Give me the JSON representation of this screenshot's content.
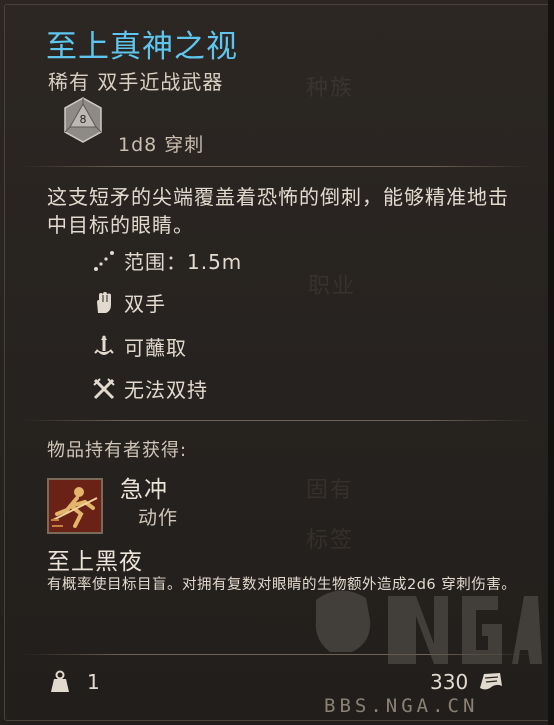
{
  "item": {
    "name": "至上真神之视",
    "rarity_type": "稀有 双手近战武器",
    "die_value": "8",
    "damage": "1d8 穿刺",
    "description": "这支短矛的尖端覆盖着恐怖的倒刺，能够精准地击中目标的眼睛。",
    "properties": [
      {
        "icon": "range-icon",
        "label": "范围：1.5m"
      },
      {
        "icon": "two-handed-icon",
        "label": "双手"
      },
      {
        "icon": "dippable-icon",
        "label": "可蘸取"
      },
      {
        "icon": "no-dual-wield-icon",
        "label": "无法双持"
      }
    ],
    "holder_gains_label": "物品持有者获得:",
    "action": {
      "name": "急冲",
      "type": "动作",
      "icon": "dash-action-icon"
    },
    "passive": {
      "name": "至上黑夜",
      "description": "有概率使目标目盲。对拥有复数对眼睛的生物额外造成2d6 穿刺伤害。"
    },
    "weight": "1",
    "price": "330"
  },
  "colors": {
    "title": "#5ec6ee",
    "text": "#e2dace",
    "panel": "#2a2521"
  }
}
